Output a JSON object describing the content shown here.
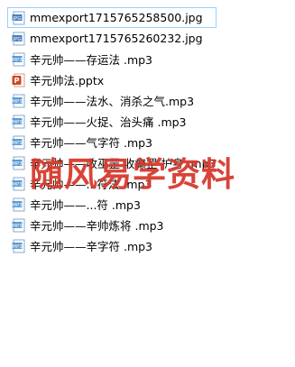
{
  "files": [
    {
      "name": "mmexport1715765258500.jpg",
      "icon": "jpg-file-icon",
      "focused": true
    },
    {
      "name": "mmexport1715765260232.jpg",
      "icon": "jpg-file-icon",
      "focused": false
    },
    {
      "name": "辛元帅——存运法 .mp3",
      "icon": "mp3-file-icon",
      "focused": false
    },
    {
      "name": "辛元帅法.pptx",
      "icon": "pptx-file-icon",
      "focused": false
    },
    {
      "name": "辛元帅——法水、消杀之气.mp3",
      "icon": "mp3-file-icon",
      "focused": false
    },
    {
      "name": "辛元帅——火捉、治头痛 .mp3",
      "icon": "mp3-file-icon",
      "focused": false
    },
    {
      "name": "辛元帅——气字符 .mp3",
      "icon": "mp3-file-icon",
      "focused": false
    },
    {
      "name": "辛元帅——收巫罡  收癫罡 护身 .mp3",
      "icon": "mp3-file-icon",
      "focused": false
    },
    {
      "name": "辛元帅——...符法 .mp3",
      "icon": "mp3-file-icon",
      "focused": false
    },
    {
      "name": "辛元帅——...符 .mp3",
      "icon": "mp3-file-icon",
      "focused": false
    },
    {
      "name": "辛元帅——辛帅炼将 .mp3",
      "icon": "mp3-file-icon",
      "focused": false
    },
    {
      "name": "辛元帅——辛字符 .mp3",
      "icon": "mp3-file-icon",
      "focused": false
    }
  ],
  "watermark": "随风易学资料",
  "colors": {
    "watermark": "#d63b2e",
    "selection_border": "#99d1ff",
    "jpg_icon": "#4a7fc1",
    "mp3_icon": "#5b9bd5",
    "pptx_icon": "#d24726"
  }
}
